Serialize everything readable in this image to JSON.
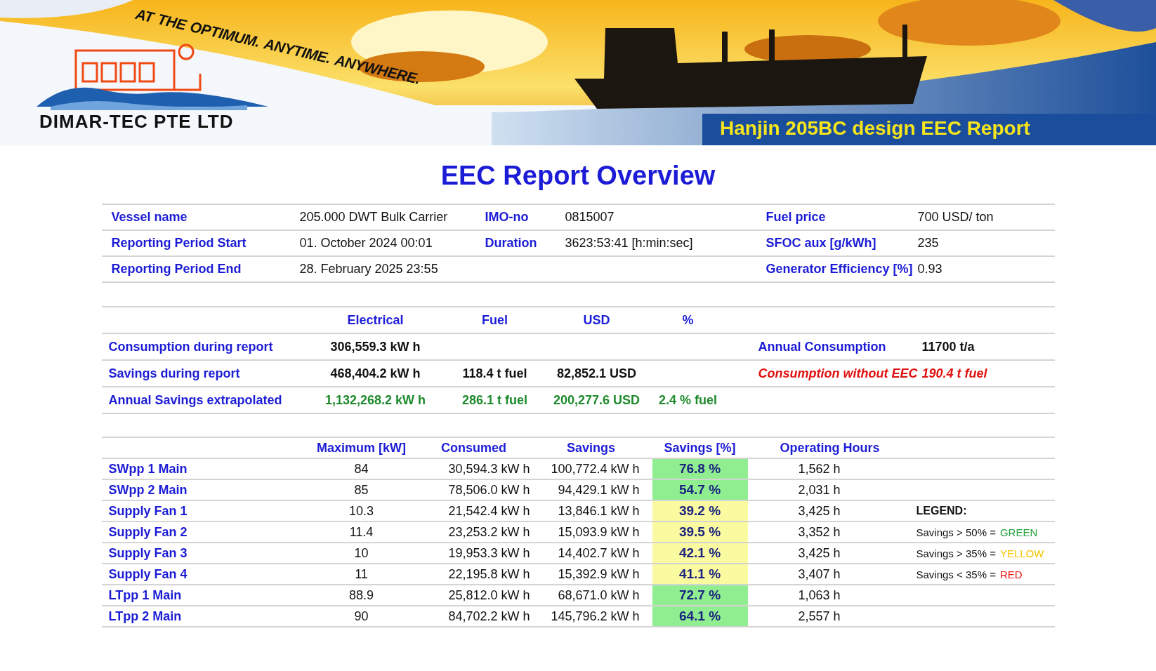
{
  "header": {
    "tagline": [
      "AT",
      "THE",
      "OPTIMUM.",
      "ANYTIME.",
      "ANYWHERE."
    ],
    "company": "DIMAR-TEC PTE LTD",
    "report_title": "Hanjin 205BC design EEC Report"
  },
  "title": "EEC Report Overview",
  "info_rows": [
    [
      {
        "label": "Vessel name",
        "value": "205.000 DWT Bulk Carrier"
      },
      {
        "label": "IMO-no",
        "value": "0815007"
      },
      {
        "label": "Fuel price",
        "value": "700 USD/ ton"
      }
    ],
    [
      {
        "label": "Reporting Period Start",
        "value": "01. October 2024 00:01"
      },
      {
        "label": "Duration",
        "value": "3623:53:41 [h:min:sec]"
      },
      {
        "label": "SFOC aux [g/kWh]",
        "value": "235"
      }
    ],
    [
      {
        "label": "Reporting Period End",
        "value": "28. February 2025 23:55"
      },
      {},
      {
        "label": "Generator Efficiency [%]",
        "value": "0.93"
      }
    ]
  ],
  "summary": {
    "columns": [
      "Electrical",
      "Fuel",
      "USD",
      "%"
    ],
    "rows": [
      {
        "kind": "plain",
        "label": "Consumption during report",
        "cells": [
          "306,559.3 kW h"
        ],
        "side": {
          "kind": "plain",
          "label": "Annual Consumption",
          "value": "11700 t/a"
        }
      },
      {
        "kind": "plain",
        "label": "Savings during report",
        "cells": [
          "468,404.2 kW h",
          "118.4 t fuel",
          "82,852.1 USD"
        ],
        "side": {
          "kind": "alert",
          "label": "Consumption without EEC",
          "value": "190.4 t fuel"
        }
      },
      {
        "kind": "annual",
        "label": "Annual Savings extrapolated",
        "cells": [
          "1,132,268.2 kW h",
          "286.1 t fuel",
          "200,277.6 USD",
          "2.4 % fuel"
        ]
      }
    ]
  },
  "devices": {
    "columns": [
      "Maximum [kW]",
      "Consumed",
      "Savings",
      "Savings [%]",
      "Operating Hours"
    ],
    "rows": [
      {
        "name": "SWpp 1 Main",
        "maximum": "84",
        "consumed": "30,594.3 kW h",
        "savings": "100,772.4 kW h",
        "savings_pct": "76.8 %",
        "color": "#90ee90",
        "hours": "1,562 h"
      },
      {
        "name": "SWpp 2 Main",
        "maximum": "85",
        "consumed": "78,506.0 kW h",
        "savings": "94,429.1 kW h",
        "savings_pct": "54.7 %",
        "color": "#90ee90",
        "hours": "2,031 h"
      },
      {
        "name": "Supply Fan 1",
        "maximum": "10.3",
        "consumed": "21,542.4 kW h",
        "savings": "13,846.1 kW h",
        "savings_pct": "39.2 %",
        "color": "#fafaa0",
        "hours": "3,425 h"
      },
      {
        "name": "Supply Fan 2",
        "maximum": "11.4",
        "consumed": "23,253.2 kW h",
        "savings": "15,093.9 kW h",
        "savings_pct": "39.5 %",
        "color": "#fafaa0",
        "hours": "3,352 h"
      },
      {
        "name": "Supply Fan 3",
        "maximum": "10",
        "consumed": "19,953.3 kW h",
        "savings": "14,402.7 kW h",
        "savings_pct": "42.1 %",
        "color": "#fafaa0",
        "hours": "3,425 h"
      },
      {
        "name": "Supply Fan 4",
        "maximum": "11",
        "consumed": "22,195.8 kW h",
        "savings": "15,392.9 kW h",
        "savings_pct": "41.1 %",
        "color": "#fafaa0",
        "hours": "3,407 h"
      },
      {
        "name": "LTpp 1 Main",
        "maximum": "88.9",
        "consumed": "25,812.0 kW h",
        "savings": "68,671.0 kW h",
        "savings_pct": "72.7 %",
        "color": "#90ee90",
        "hours": "1,063 h"
      },
      {
        "name": "LTpp 2 Main",
        "maximum": "90",
        "consumed": "84,702.2 kW h",
        "savings": "145,796.2 kW h",
        "savings_pct": "64.1 %",
        "color": "#90ee90",
        "hours": "2,557 h"
      }
    ]
  },
  "legend": {
    "title": "LEGEND:",
    "items": [
      {
        "text": "Savings > 50% =",
        "color_name": "GREEN",
        "color": "#22a33a"
      },
      {
        "text": "Savings > 35% =",
        "color_name": "YELLOW",
        "color": "#f5c400"
      },
      {
        "text": "Savings < 35% =",
        "color_name": "RED",
        "color": "#ee1111"
      }
    ]
  }
}
